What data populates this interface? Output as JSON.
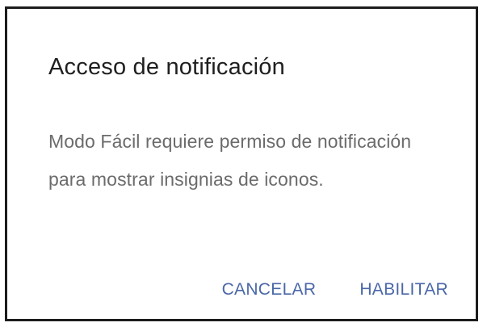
{
  "dialog": {
    "title": "Acceso de notificación",
    "message": "Modo Fácil requiere permiso de notificación para mostrar insignias de iconos.",
    "buttons": {
      "cancel_label": "CANCELAR",
      "enable_label": "HABILITAR"
    }
  },
  "colors": {
    "title_text": "#1f1f1f",
    "message_text": "#6b6b6b",
    "button_text": "#4a67a8",
    "background": "#ffffff"
  }
}
